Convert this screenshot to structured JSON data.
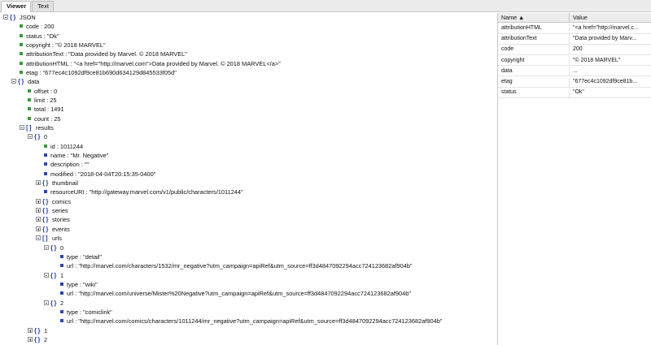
{
  "tabs": {
    "viewer": "Viewer",
    "text": "Text"
  },
  "tree": [
    {
      "depth": 0,
      "toggle": "minus",
      "kind": "obj",
      "label": "JSON"
    },
    {
      "depth": 1,
      "kind": "green",
      "label": "code : 200"
    },
    {
      "depth": 1,
      "kind": "green",
      "label": "status : \"Ok\""
    },
    {
      "depth": 1,
      "kind": "green",
      "label": "copyright : \"© 2018 MARVEL\""
    },
    {
      "depth": 1,
      "kind": "green",
      "label": "attributionText : \"Data provided by Marvel. © 2018 MARVEL\""
    },
    {
      "depth": 1,
      "kind": "green",
      "label": "attributionHTML : \"<a href=\"http://marvel.com\">Data provided by Marvel. © 2018 MARVEL</a>\""
    },
    {
      "depth": 1,
      "kind": "green",
      "label": "etag : \"677ec4c1092df9ce81b690d634129d845533f05d\""
    },
    {
      "depth": 1,
      "toggle": "minus",
      "kind": "obj",
      "label": "data"
    },
    {
      "depth": 2,
      "kind": "green",
      "label": "offset : 0"
    },
    {
      "depth": 2,
      "kind": "green",
      "label": "limit : 25"
    },
    {
      "depth": 2,
      "kind": "green",
      "label": "total : 1491"
    },
    {
      "depth": 2,
      "kind": "green",
      "label": "count : 25"
    },
    {
      "depth": 2,
      "toggle": "minus",
      "kind": "arr",
      "label": "results"
    },
    {
      "depth": 3,
      "toggle": "minus",
      "kind": "obj",
      "label": "0"
    },
    {
      "depth": 4,
      "kind": "green",
      "label": "id : 1011244"
    },
    {
      "depth": 4,
      "kind": "blue",
      "label": "name : \"Mr. Negative\""
    },
    {
      "depth": 4,
      "kind": "blue",
      "label": "description : \"\""
    },
    {
      "depth": 4,
      "kind": "blue",
      "label": "modified : \"2018-04-04T20:15:35-0400\""
    },
    {
      "depth": 4,
      "toggle": "plus",
      "kind": "obj",
      "label": "thumbnail"
    },
    {
      "depth": 4,
      "kind": "blue",
      "label": "resourceURI : \"http://gateway.marvel.com/v1/public/characters/1011244\""
    },
    {
      "depth": 4,
      "toggle": "plus",
      "kind": "obj",
      "label": "comics"
    },
    {
      "depth": 4,
      "toggle": "plus",
      "kind": "obj",
      "label": "series"
    },
    {
      "depth": 4,
      "toggle": "plus",
      "kind": "obj",
      "label": "stories"
    },
    {
      "depth": 4,
      "toggle": "plus",
      "kind": "obj",
      "label": "events"
    },
    {
      "depth": 4,
      "toggle": "minus",
      "kind": "arr",
      "label": "urls"
    },
    {
      "depth": 5,
      "toggle": "minus",
      "kind": "obj",
      "label": "0"
    },
    {
      "depth": 6,
      "kind": "blue",
      "label": "type : \"detail\""
    },
    {
      "depth": 6,
      "kind": "blue",
      "label": "url : \"http://marvel.com/characters/1532/mr_negative?utm_campaign=apiRef&utm_source=ff3d4847092294acc724123682af904b\""
    },
    {
      "depth": 5,
      "toggle": "minus",
      "kind": "obj",
      "label": "1"
    },
    {
      "depth": 6,
      "kind": "blue",
      "label": "type : \"wiki\""
    },
    {
      "depth": 6,
      "kind": "blue",
      "label": "url : \"http://marvel.com/universe/Mister%20Negative?utm_campaign=apiRef&utm_source=ff3d4847092294acc724123682af904b\""
    },
    {
      "depth": 5,
      "toggle": "minus",
      "kind": "obj",
      "label": "2"
    },
    {
      "depth": 6,
      "kind": "blue",
      "label": "type : \"comiclink\""
    },
    {
      "depth": 6,
      "kind": "blue",
      "label": "url : \"http://marvel.com/comics/characters/1011244/mr_negative?utm_campaign=apiRef&utm_source=ff3d4847092294acc724123682af904b\""
    },
    {
      "depth": 3,
      "toggle": "plus",
      "kind": "obj",
      "label": "1"
    },
    {
      "depth": 3,
      "toggle": "plus",
      "kind": "obj",
      "label": "2"
    }
  ],
  "grid": {
    "header": {
      "name": "Name ▲",
      "value": "Value"
    },
    "rows": [
      {
        "name": "attributionHTML",
        "value": "\"<a href=\"http://marvel.c..."
      },
      {
        "name": "attributionText",
        "value": "\"Data provided by Marv..."
      },
      {
        "name": "code",
        "value": "200"
      },
      {
        "name": "copyright",
        "value": "\"© 2018 MARVEL\""
      },
      {
        "name": "data",
        "value": "..."
      },
      {
        "name": "etag",
        "value": "\"677ec4c1092df9ce81b..."
      },
      {
        "name": "status",
        "value": "\"Ok\""
      }
    ]
  },
  "colors": {
    "object_icon": "#2a48a8",
    "number_marker": "#3a9a3a",
    "string_marker": "#2a48a8"
  }
}
